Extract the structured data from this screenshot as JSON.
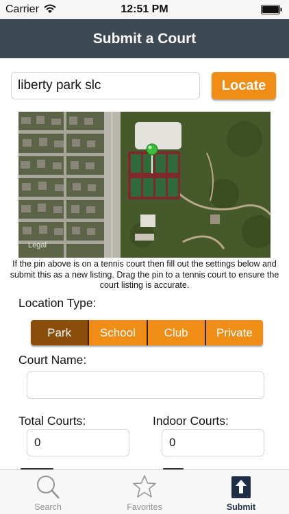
{
  "status_bar": {
    "carrier": "Carrier",
    "time": "12:51 PM"
  },
  "nav": {
    "title": "Submit a Court"
  },
  "search": {
    "value": "liberty park slc",
    "button_label": "Locate"
  },
  "map": {
    "legal_label": "Legal",
    "instructions": "If the pin above is on a tennis court then fill out the settings below and submit this as a new listing. Drag the pin to a tennis court to ensure the court listing is accurate."
  },
  "form": {
    "location_type_label": "Location Type:",
    "location_types": [
      "Park",
      "School",
      "Club",
      "Private"
    ],
    "selected_location_type": "Park",
    "court_name_label": "Court Name:",
    "court_name_value": "",
    "total_courts_label": "Total Courts:",
    "total_courts_value": "0",
    "indoor_courts_label": "Indoor Courts:",
    "indoor_courts_value": "0"
  },
  "tabs": [
    {
      "label": "Search",
      "icon": "search-icon",
      "active": false
    },
    {
      "label": "Favorites",
      "icon": "star-icon",
      "active": false
    },
    {
      "label": "Submit",
      "icon": "upload-icon",
      "active": true
    }
  ],
  "colors": {
    "nav_background": "#3d4a54",
    "accent_orange": "#ef8d17",
    "selected_segment": "#8a4e0a",
    "tab_active": "#1e2e47",
    "tab_inactive": "#929292",
    "map_pin": "#3dbb3d"
  }
}
